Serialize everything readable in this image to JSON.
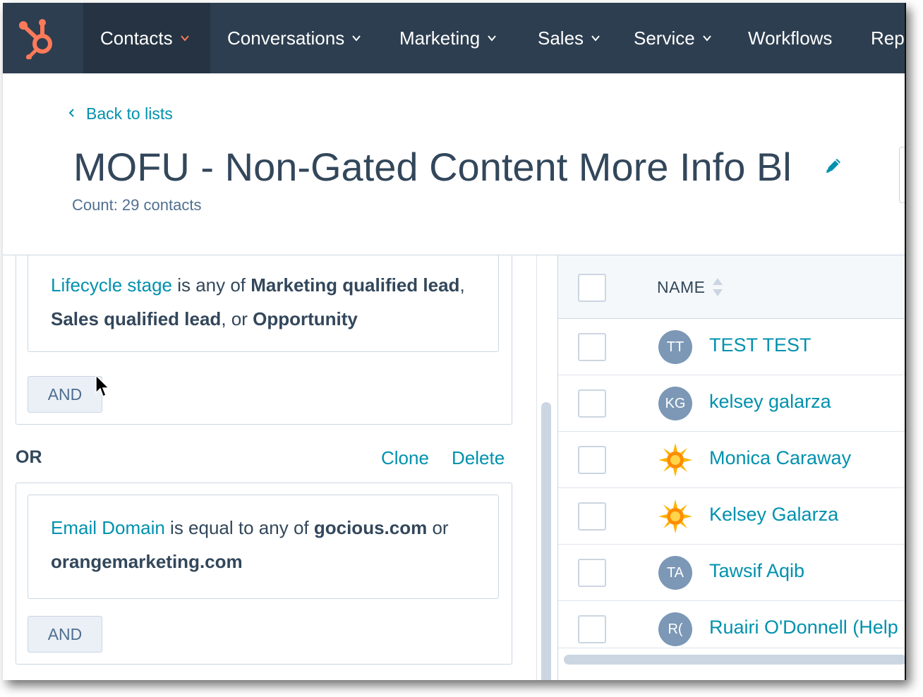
{
  "nav": {
    "items": [
      {
        "label": "Contacts",
        "has_chevron": true,
        "active": true
      },
      {
        "label": "Conversations",
        "has_chevron": true,
        "active": false
      },
      {
        "label": "Marketing",
        "has_chevron": true,
        "active": false
      },
      {
        "label": "Sales",
        "has_chevron": true,
        "active": false
      },
      {
        "label": "Service",
        "has_chevron": true,
        "active": false
      },
      {
        "label": "Workflows",
        "has_chevron": false,
        "active": false
      },
      {
        "label": "Repo",
        "has_chevron": false,
        "active": false
      }
    ],
    "logo_icon": "hubspot-sprocket-icon",
    "brand_color": "#ff7a59",
    "bg_color": "#2d3e50"
  },
  "header": {
    "back_label": "Back to lists",
    "title": "MOFU - Non-Gated Content More Info Bl",
    "count_text": "Count: 29 contacts"
  },
  "filters": {
    "group1": {
      "property": "Lifecycle stage",
      "operator": " is any of ",
      "values": [
        "Marketing qualified lead",
        "Sales qualified lead",
        "Opportunity"
      ],
      "sep1": ", ",
      "sep2": ", or ",
      "and_label": "AND"
    },
    "or_label": "OR",
    "clone_label": "Clone",
    "delete_label": "Delete",
    "group2": {
      "property": "Email Domain",
      "operator": " is equal to any of ",
      "values": [
        "gocious.com",
        "orangemarketing.com"
      ],
      "sep1": " or ",
      "and_label": "AND"
    }
  },
  "table": {
    "header_name": "NAME",
    "rows": [
      {
        "initials": "TT",
        "name": "TEST TEST",
        "avatar": "initials"
      },
      {
        "initials": "KG",
        "name": "kelsey galarza",
        "avatar": "initials"
      },
      {
        "initials": "",
        "name": "Monica Caraway",
        "avatar": "sun-icon"
      },
      {
        "initials": "",
        "name": "Kelsey Galarza",
        "avatar": "sun-icon"
      },
      {
        "initials": "TA",
        "name": "Tawsif Aqib",
        "avatar": "initials"
      },
      {
        "initials": "R(",
        "name": "Ruairi O'Donnell (Help",
        "avatar": "initials"
      }
    ]
  }
}
